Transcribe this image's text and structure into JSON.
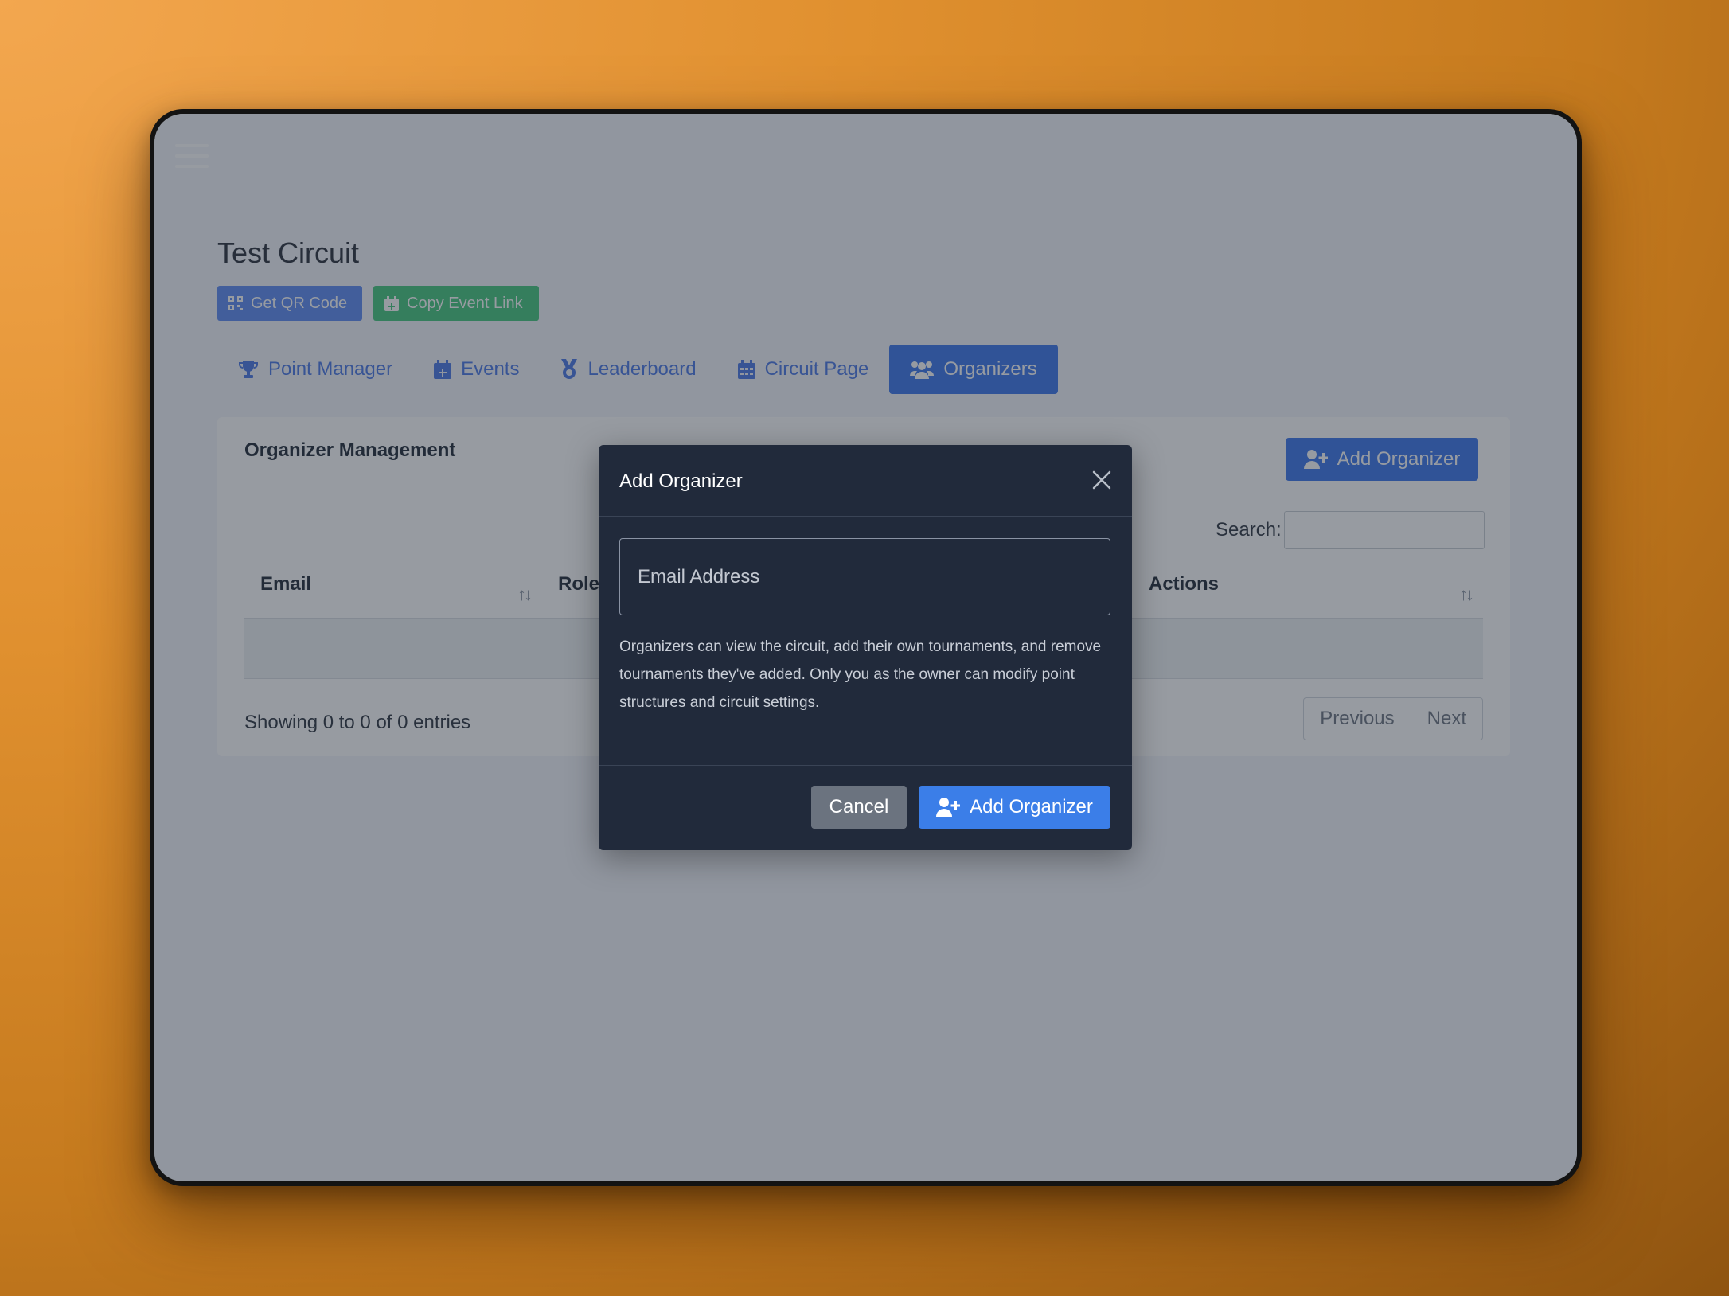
{
  "app": {
    "title": "Test Circuit",
    "buttons": {
      "qr": "Get QR Code",
      "copy_link": "Copy Event Link"
    },
    "tabs": [
      {
        "label": "Point Manager",
        "icon": "trophy-icon",
        "active": false
      },
      {
        "label": "Events",
        "icon": "calendar-plus-icon",
        "active": false
      },
      {
        "label": "Leaderboard",
        "icon": "medal-icon",
        "active": false
      },
      {
        "label": "Circuit Page",
        "icon": "calendar-icon",
        "active": false
      },
      {
        "label": "Organizers",
        "icon": "users-icon",
        "active": true
      }
    ]
  },
  "card": {
    "title": "Organizer Management",
    "add_button": "Add Organizer",
    "search_label": "Search:",
    "columns": [
      "Email",
      "Role",
      "Actions"
    ],
    "info": "Showing 0 to 0 of 0 entries",
    "pagination": {
      "previous": "Previous",
      "next": "Next"
    }
  },
  "modal": {
    "title": "Add Organizer",
    "email_placeholder": "Email Address",
    "help": "Organizers can view the circuit, add their own tournaments, and remove tournaments they've added. Only you as the owner can modify point structures and circuit settings.",
    "cancel": "Cancel",
    "submit": "Add Organizer"
  },
  "colors": {
    "primary": "#3b76ec",
    "success": "#44c77e",
    "modal_bg": "#212a3b",
    "backdrop": "#e0902f"
  }
}
